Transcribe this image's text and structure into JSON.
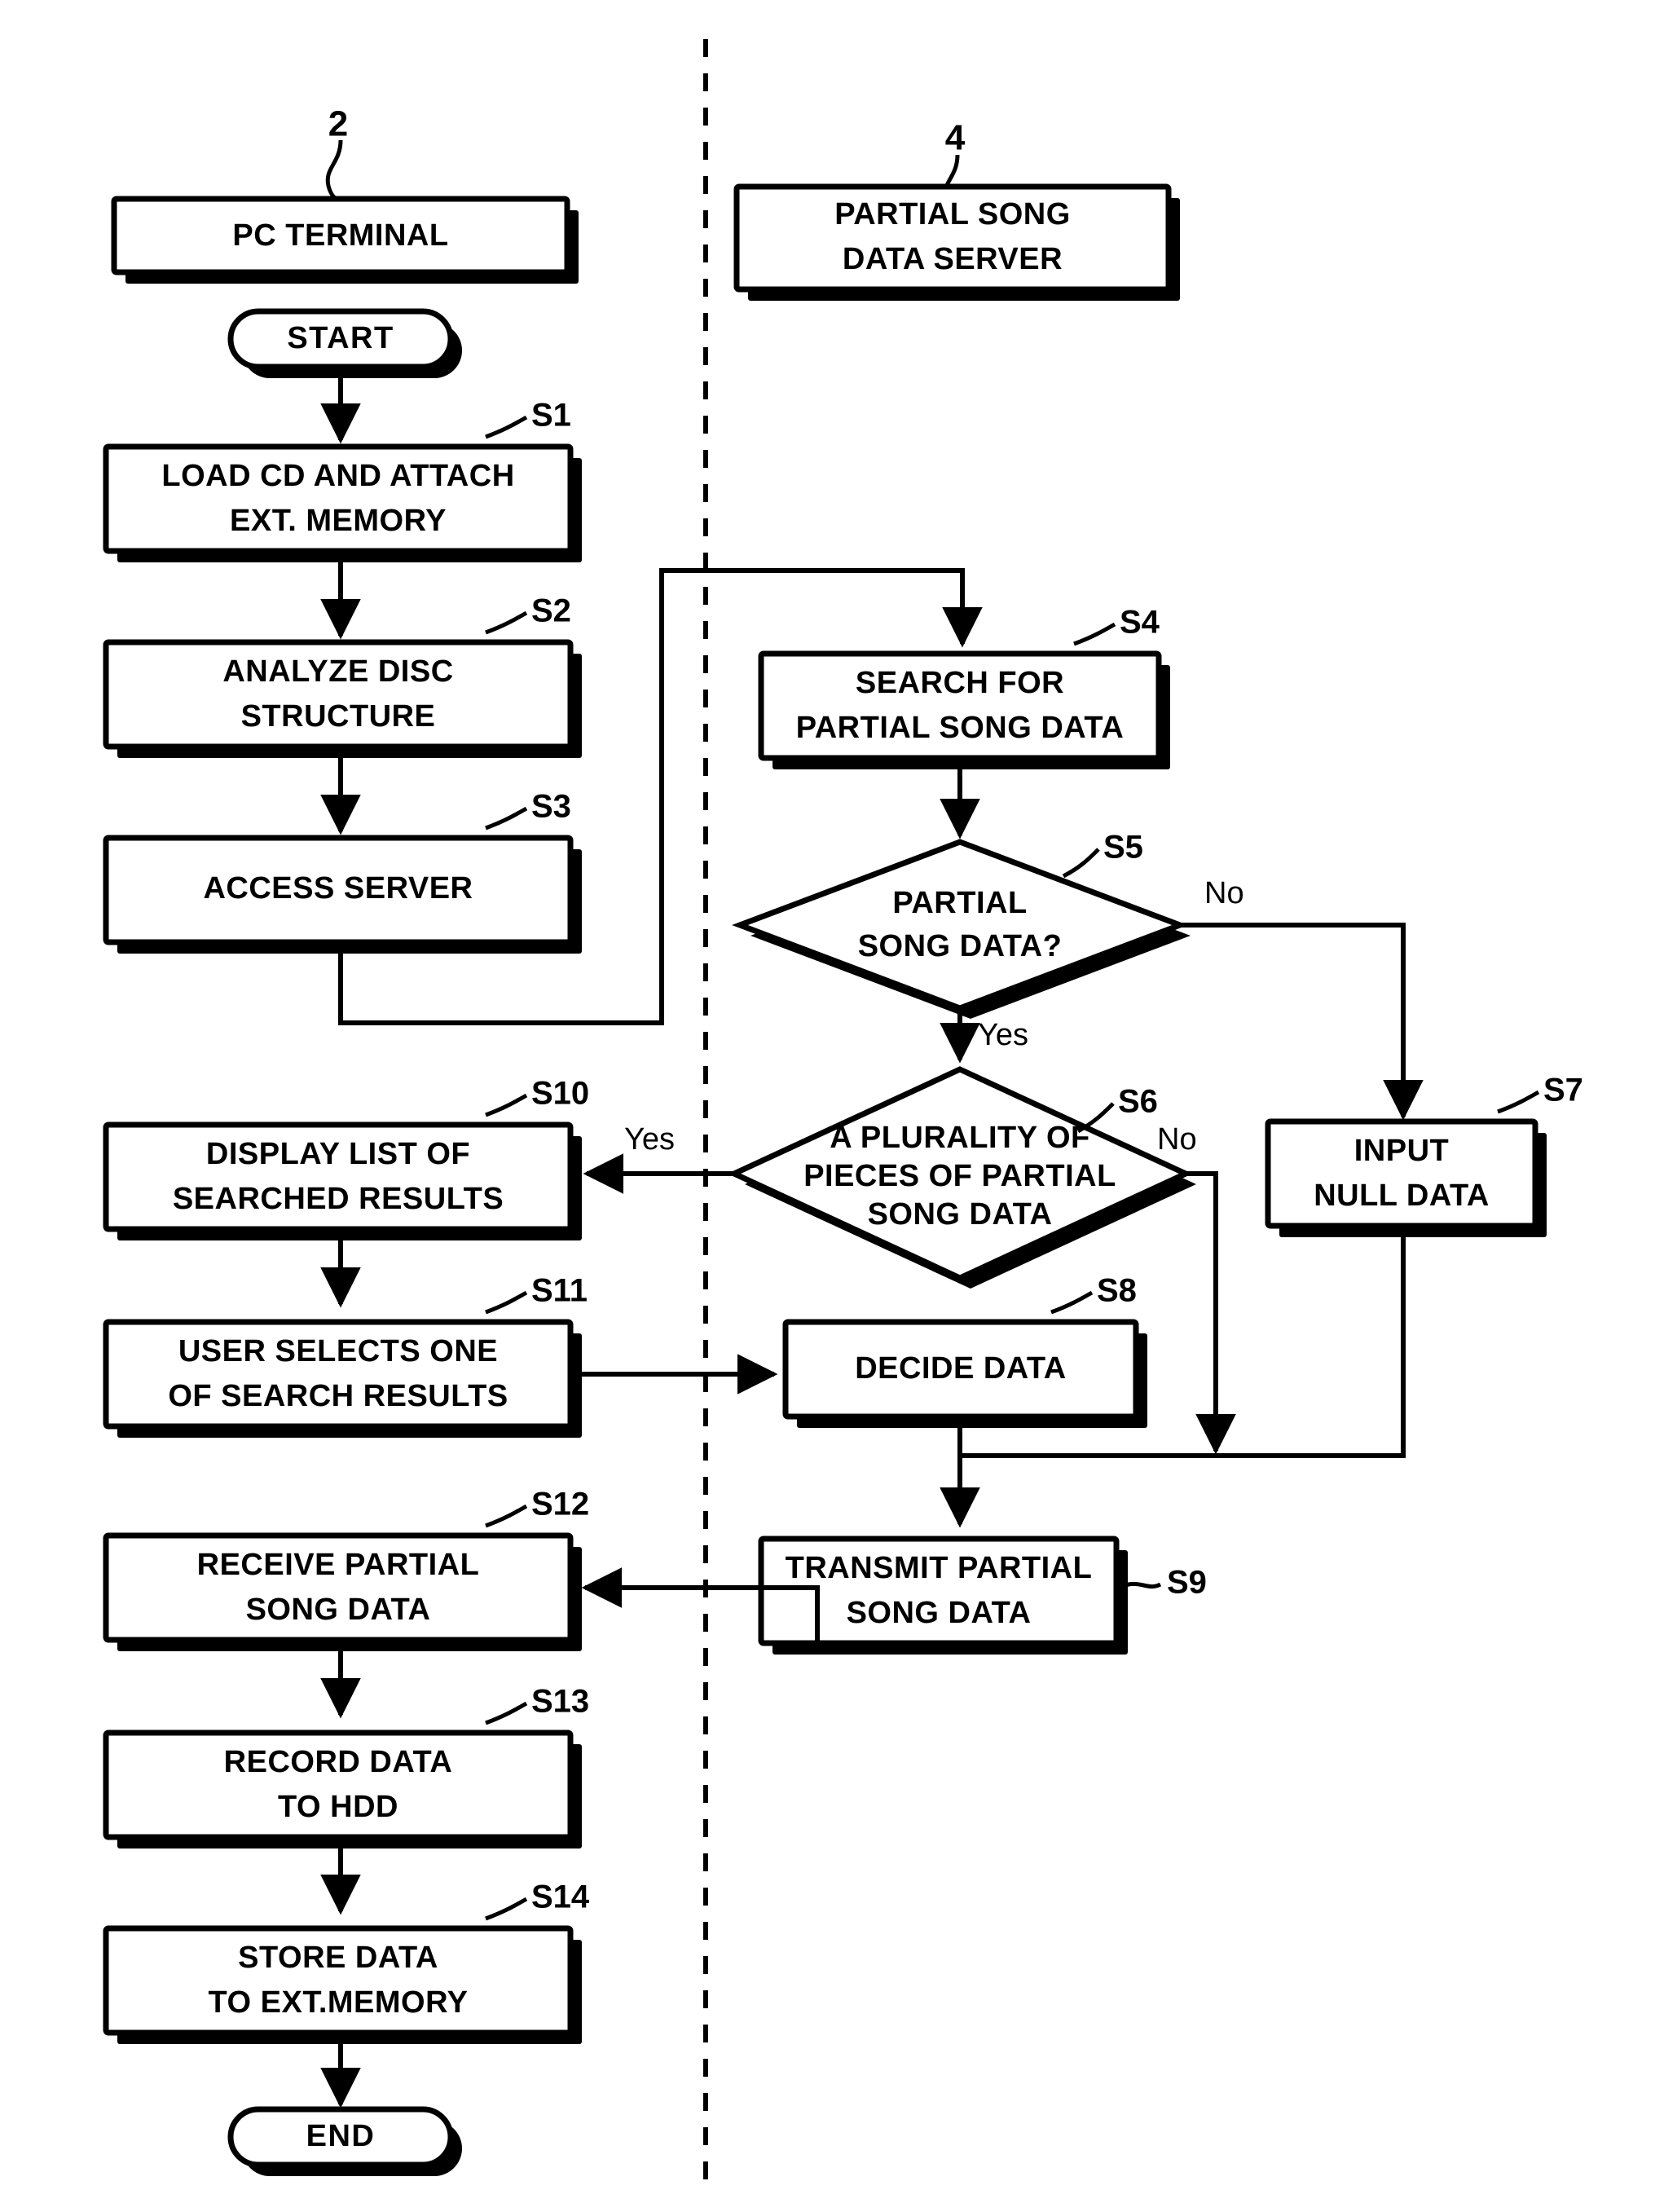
{
  "figure": {
    "type": "patent-flowchart",
    "background_color": "#ffffff",
    "line_color": "#000000"
  },
  "divider": {
    "name": "vertical-dashed-separator"
  },
  "lanes": [
    {
      "id": "left",
      "ref_number": "2",
      "header_label": "PC TERMINAL"
    },
    {
      "id": "right",
      "ref_number": "4",
      "header_line1": "PARTIAL SONG",
      "header_line2": "DATA SERVER"
    }
  ],
  "terminators": {
    "start": "START",
    "end": "END"
  },
  "branch_labels": {
    "s5_no": "No",
    "s5_yes": "Yes",
    "s6_yes": "Yes",
    "s6_no": "No"
  },
  "steps": [
    {
      "id": "S1",
      "label": "S1",
      "lane": "left",
      "line1": "LOAD CD AND ATTACH",
      "line2": "EXT. MEMORY"
    },
    {
      "id": "S2",
      "label": "S2",
      "lane": "left",
      "line1": "ANALYZE DISC",
      "line2": "STRUCTURE"
    },
    {
      "id": "S3",
      "label": "S3",
      "lane": "left",
      "line1": "ACCESS SERVER",
      "line2": ""
    },
    {
      "id": "S4",
      "label": "S4",
      "lane": "right",
      "line1": "SEARCH FOR",
      "line2": "PARTIAL SONG DATA"
    },
    {
      "id": "S5",
      "label": "S5",
      "lane": "right",
      "shape": "decision",
      "line1": "PARTIAL",
      "line2": "SONG DATA?",
      "line3": ""
    },
    {
      "id": "S6",
      "label": "S6",
      "lane": "right",
      "shape": "decision",
      "line1": "A PLURALITY OF",
      "line2": "PIECES OF PARTIAL",
      "line3": "SONG DATA"
    },
    {
      "id": "S7",
      "label": "S7",
      "lane": "right",
      "line1": "INPUT",
      "line2": "NULL DATA"
    },
    {
      "id": "S8",
      "label": "S8",
      "lane": "right",
      "line1": "DECIDE DATA",
      "line2": ""
    },
    {
      "id": "S9",
      "label": "S9",
      "lane": "right",
      "line1": "TRANSMIT PARTIAL",
      "line2": "SONG DATA"
    },
    {
      "id": "S10",
      "label": "S10",
      "lane": "left",
      "line1": "DISPLAY LIST OF",
      "line2": "SEARCHED RESULTS"
    },
    {
      "id": "S11",
      "label": "S11",
      "lane": "left",
      "line1": "USER SELECTS ONE",
      "line2": "OF SEARCH RESULTS"
    },
    {
      "id": "S12",
      "label": "S12",
      "lane": "left",
      "line1": "RECEIVE PARTIAL",
      "line2": "SONG DATA"
    },
    {
      "id": "S13",
      "label": "S13",
      "lane": "left",
      "line1": "RECORD DATA",
      "line2": "TO HDD"
    },
    {
      "id": "S14",
      "label": "S14",
      "lane": "left",
      "line1": "STORE DATA",
      "line2": "TO EXT.MEMORY"
    }
  ]
}
